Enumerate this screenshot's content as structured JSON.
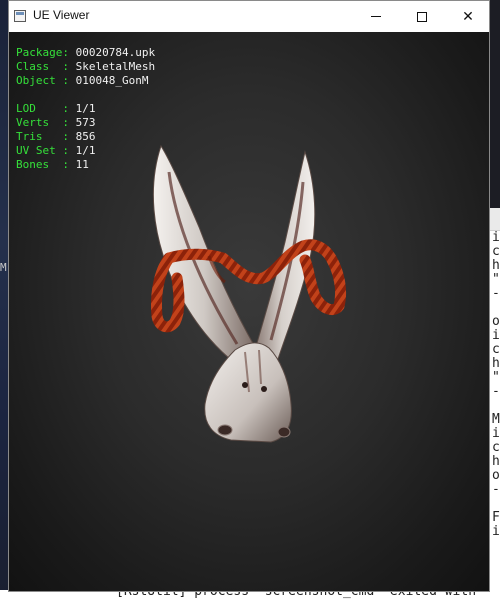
{
  "window": {
    "title": "UE Viewer",
    "controls": {
      "minimize": "—",
      "maximize": "☐",
      "close": "✕"
    }
  },
  "info": {
    "package": {
      "label": "Package: ",
      "value": "00020784.upk"
    },
    "class": {
      "label": "Class  : ",
      "value": "SkeletalMesh"
    },
    "object": {
      "label": "Object : ",
      "value": "010048_GonM"
    },
    "lod": {
      "label": "LOD    : ",
      "value": "1/1"
    },
    "verts": {
      "label": "Verts  : ",
      "value": "573"
    },
    "tris": {
      "label": "Tris   : ",
      "value": "856"
    },
    "uvset": {
      "label": "UV Set : ",
      "value": "1/1"
    },
    "bones": {
      "label": "Bones  : ",
      "value": "11"
    }
  },
  "colors": {
    "label_green": "#35e03a",
    "value_white": "#f0f0f0",
    "rope": "#9a2a0c"
  },
  "background": {
    "console_lines": [
      "i",
      "c",
      "h",
      "\"",
      "-",
      "",
      "o",
      "i",
      "c",
      "h",
      "\"",
      "-",
      "",
      "M",
      "i",
      "c",
      "h",
      "o",
      "-",
      "",
      "F",
      "i"
    ],
    "left_stray": "M",
    "bottom_console": "[RstUtil] process \"screenshot_cmd\" exited with"
  }
}
